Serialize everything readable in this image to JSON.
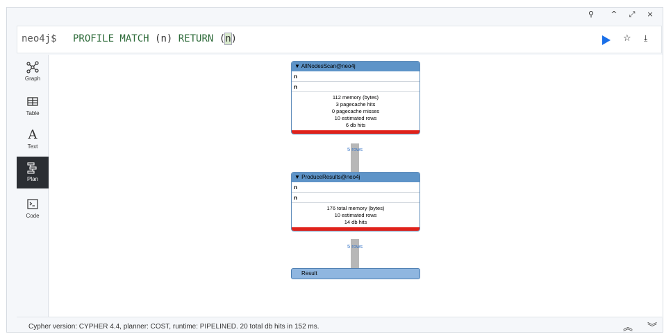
{
  "window_controls": {
    "pin": "⚲",
    "up": "^",
    "expand": "⤢",
    "close": "×"
  },
  "editor": {
    "prompt": "neo4j$",
    "query_keywords_1": "PROFILE MATCH ",
    "query_paren_1": "(n) ",
    "query_keywords_2": "RETURN ",
    "query_paren_open": "(",
    "query_highlight": "n",
    "query_paren_close": ")"
  },
  "sidebar": {
    "items": [
      {
        "label": "Graph",
        "icon": "graph-icon"
      },
      {
        "label": "Table",
        "icon": "table-icon"
      },
      {
        "label": "Text",
        "icon": "text-icon",
        "glyph": "A"
      },
      {
        "label": "Plan",
        "icon": "plan-icon"
      },
      {
        "label": "Code",
        "icon": "code-icon"
      }
    ],
    "active": "Plan"
  },
  "plan": {
    "operators": [
      {
        "title": "▼ AllNodesScan@neo4j",
        "rows": [
          "n",
          "n"
        ],
        "stats": [
          "112 memory (bytes)",
          "3 pagecache hits",
          "0 pagecache misses",
          "10 estimated rows",
          "6 db hits"
        ]
      },
      {
        "title": "▼ ProduceResults@neo4j",
        "rows": [
          "n",
          "n"
        ],
        "stats": [
          "176 total memory (bytes)",
          "10 estimated rows",
          "14 db hits"
        ]
      }
    ],
    "pipes": [
      "5 rows",
      "5 rows"
    ],
    "result": "Result"
  },
  "footer": {
    "text": "Cypher version: CYPHER 4.4, planner: COST, runtime: PIPELINED. 20 total db hits in 152 ms."
  },
  "colors": {
    "accent": "#1a6fe8",
    "op_header": "#5e94c8",
    "op_bar": "#e0211a",
    "result": "#8fb6e0"
  }
}
